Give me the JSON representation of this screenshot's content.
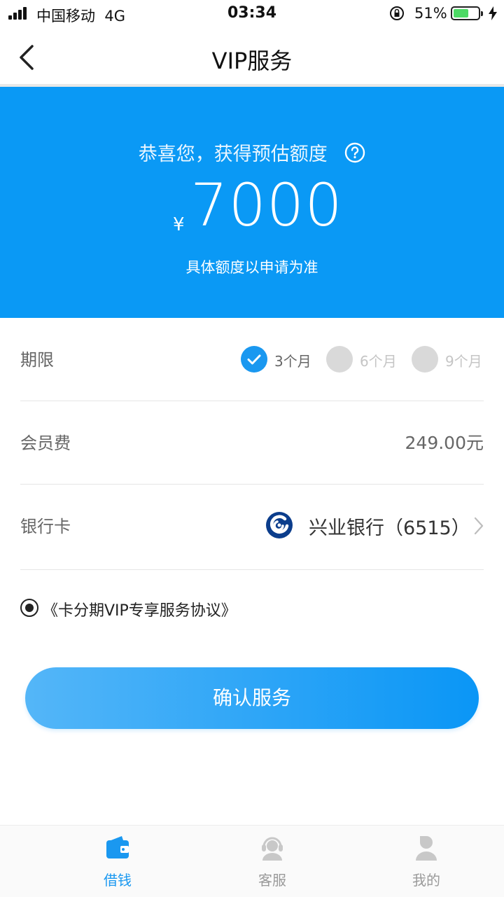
{
  "status_bar": {
    "carrier": "中国移动",
    "network": "4G",
    "time": "03:34",
    "battery": "51%",
    "battery_level": 0.51,
    "signal_bars": 4
  },
  "nav": {
    "title": "VIP服务"
  },
  "hero": {
    "title": "恭喜您，获得预估额度",
    "currency": "¥",
    "amount": "7000",
    "note": "具体额度以申请为准"
  },
  "period": {
    "label": "期限",
    "options": [
      {
        "label": "3个月",
        "selected": true
      },
      {
        "label": "6个月",
        "selected": false
      },
      {
        "label": "9个月",
        "selected": false
      }
    ]
  },
  "fee": {
    "label": "会员费",
    "value": "249.00元"
  },
  "bank": {
    "label": "银行卡",
    "name": "兴业银行（6515）"
  },
  "agreement": {
    "text": "《卡分期VIP专享服务协议》",
    "checked": true
  },
  "confirm_label": "确认服务",
  "tabs": [
    {
      "label": "借钱",
      "icon": "wallet-icon",
      "active": true
    },
    {
      "label": "客服",
      "icon": "headset-icon",
      "active": false
    },
    {
      "label": "我的",
      "icon": "person-icon",
      "active": false
    }
  ],
  "colors": {
    "primary": "#0a99f5",
    "accent": "#1a98f0",
    "battery": "#4cd964",
    "inactive": "#c8c8c8"
  }
}
